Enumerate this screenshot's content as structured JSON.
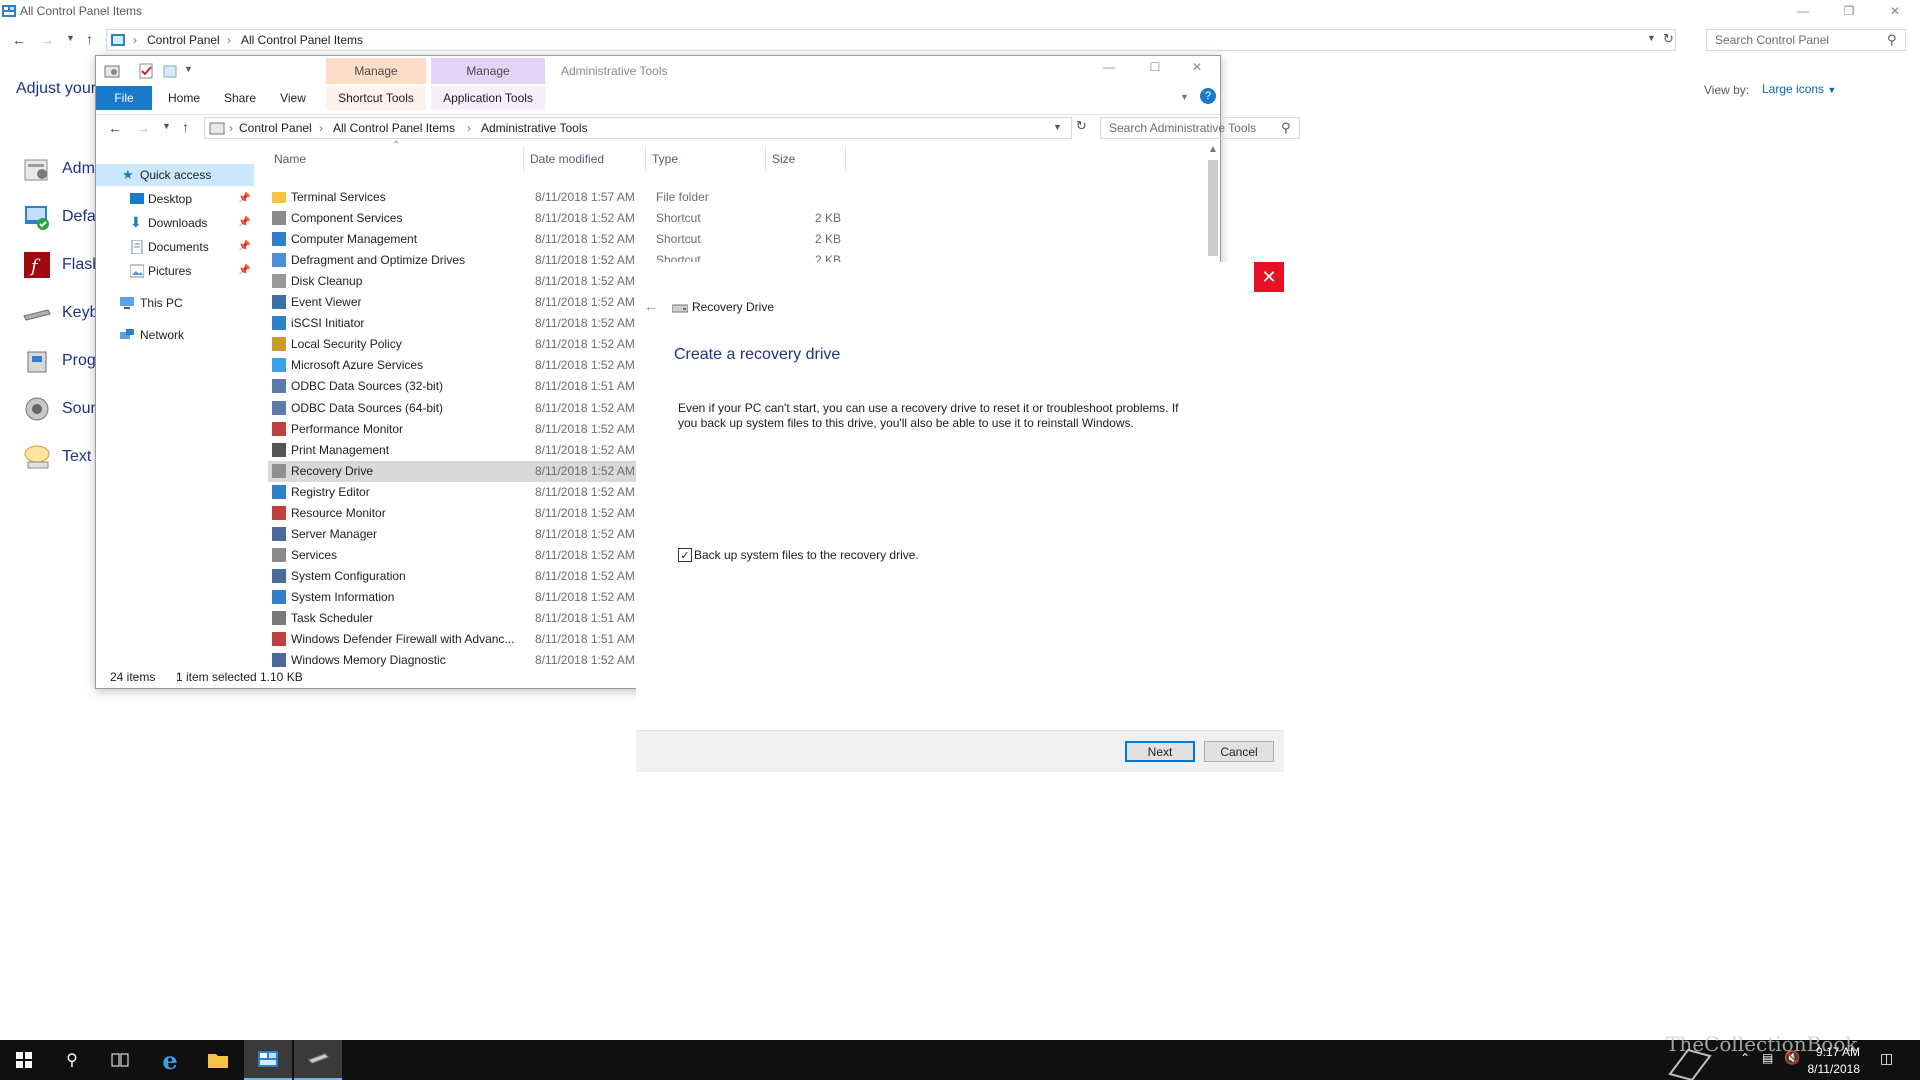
{
  "control_panel": {
    "title": "All Control Panel Items",
    "breadcrumb": [
      "Control Panel",
      "All Control Panel Items"
    ],
    "search_placeholder": "Search Control Panel",
    "heading": "Adjust your",
    "view_by_label": "View by:",
    "view_by_value": "Large icons",
    "items": [
      "Adm",
      "Defa",
      "Flash",
      "Keyb",
      "Prog",
      "Soun",
      "Text t"
    ]
  },
  "explorer": {
    "quick_toolbar": "",
    "context_tabs": [
      "Manage",
      "Manage"
    ],
    "app_title": "Administrative Tools",
    "ribbon_tabs": {
      "file": "File",
      "home": "Home",
      "share": "Share",
      "view": "View",
      "shortcut_tools": "Shortcut Tools",
      "application_tools": "Application Tools"
    },
    "breadcrumb": [
      "Control Panel",
      "All Control Panel Items",
      "Administrative Tools"
    ],
    "search_placeholder": "Search Administrative Tools",
    "nav": {
      "quick_access": "Quick access",
      "desktop": "Desktop",
      "downloads": "Downloads",
      "documents": "Documents",
      "pictures": "Pictures",
      "this_pc": "This PC",
      "network": "Network"
    },
    "columns": {
      "name": "Name",
      "date": "Date modified",
      "type": "Type",
      "size": "Size"
    },
    "files": [
      {
        "name": "Terminal Services",
        "date": "8/11/2018 1:57 AM",
        "type": "File folder",
        "size": ""
      },
      {
        "name": "Component Services",
        "date": "8/11/2018 1:52 AM",
        "type": "Shortcut",
        "size": "2 KB"
      },
      {
        "name": "Computer Management",
        "date": "8/11/2018 1:52 AM",
        "type": "Shortcut",
        "size": "2 KB"
      },
      {
        "name": "Defragment and Optimize Drives",
        "date": "8/11/2018 1:52 AM",
        "type": "Shortcut",
        "size": "2 KB"
      },
      {
        "name": "Disk Cleanup",
        "date": "8/11/2018 1:52 AM",
        "type": "",
        "size": ""
      },
      {
        "name": "Event Viewer",
        "date": "8/11/2018 1:52 AM",
        "type": "",
        "size": ""
      },
      {
        "name": "iSCSI Initiator",
        "date": "8/11/2018 1:52 AM",
        "type": "",
        "size": ""
      },
      {
        "name": "Local Security Policy",
        "date": "8/11/2018 1:52 AM",
        "type": "",
        "size": ""
      },
      {
        "name": "Microsoft Azure Services",
        "date": "8/11/2018 1:52 AM",
        "type": "",
        "size": ""
      },
      {
        "name": "ODBC Data Sources (32-bit)",
        "date": "8/11/2018 1:51 AM",
        "type": "",
        "size": ""
      },
      {
        "name": "ODBC Data Sources (64-bit)",
        "date": "8/11/2018 1:52 AM",
        "type": "",
        "size": ""
      },
      {
        "name": "Performance Monitor",
        "date": "8/11/2018 1:52 AM",
        "type": "",
        "size": ""
      },
      {
        "name": "Print Management",
        "date": "8/11/2018 1:52 AM",
        "type": "",
        "size": ""
      },
      {
        "name": "Recovery Drive",
        "date": "8/11/2018 1:52 AM",
        "type": "",
        "size": ""
      },
      {
        "name": "Registry Editor",
        "date": "8/11/2018 1:52 AM",
        "type": "",
        "size": ""
      },
      {
        "name": "Resource Monitor",
        "date": "8/11/2018 1:52 AM",
        "type": "",
        "size": ""
      },
      {
        "name": "Server Manager",
        "date": "8/11/2018 1:52 AM",
        "type": "",
        "size": ""
      },
      {
        "name": "Services",
        "date": "8/11/2018 1:52 AM",
        "type": "",
        "size": ""
      },
      {
        "name": "System Configuration",
        "date": "8/11/2018 1:52 AM",
        "type": "",
        "size": ""
      },
      {
        "name": "System Information",
        "date": "8/11/2018 1:52 AM",
        "type": "",
        "size": ""
      },
      {
        "name": "Task Scheduler",
        "date": "8/11/2018 1:51 AM",
        "type": "",
        "size": ""
      },
      {
        "name": "Windows Defender Firewall with Advanc...",
        "date": "8/11/2018 1:51 AM",
        "type": "",
        "size": ""
      },
      {
        "name": "Windows Memory Diagnostic",
        "date": "8/11/2018 1:52 AM",
        "type": "",
        "size": ""
      }
    ],
    "selected_file": "Recovery Drive",
    "status": {
      "count": "24 items",
      "selection": "1 item selected",
      "size": "1.10 KB"
    }
  },
  "wizard": {
    "title": "Recovery Drive",
    "heading": "Create a recovery drive",
    "body": "Even if your PC can't start, you can use a recovery drive to reset it or troubleshoot problems. If you back up system files to this drive, you'll also be able to use it to reinstall Windows.",
    "checkbox_label": "Back up system files to the recovery drive.",
    "checkbox_checked": true,
    "next_label": "Next",
    "cancel_label": "Cancel"
  },
  "taskbar": {
    "time": "9:17 AM",
    "date": "8/11/2018",
    "watermark": "TheCollectionBook"
  },
  "colors": {
    "accent": "#1979ca",
    "link": "#1e3287",
    "close_red": "#e81123",
    "selection": "#cce8ff",
    "taskbar": "#101010"
  }
}
